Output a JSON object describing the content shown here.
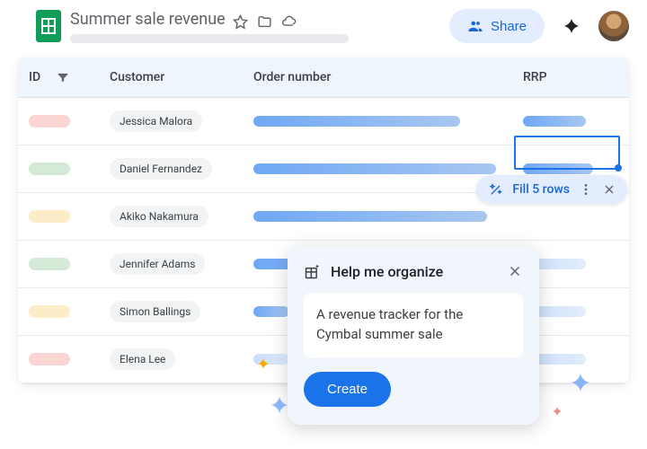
{
  "header": {
    "title": "Summer sale revenue",
    "share_label": "Share"
  },
  "table": {
    "columns": {
      "id": "ID",
      "customer": "Customer",
      "order": "Order number",
      "rrp": "RRP"
    },
    "rows": [
      {
        "id_color": "red",
        "customer": "Jessica Malora",
        "order_w": 230,
        "rrp_w": 70,
        "rrp_faded": false
      },
      {
        "id_color": "green",
        "customer": "Daniel Fernandez",
        "order_w": 270,
        "rrp_w": 78,
        "rrp_faded": false
      },
      {
        "id_color": "yellow",
        "customer": "Akiko Nakamura",
        "order_w": 260,
        "rrp_w": 0,
        "rrp_faded": false
      },
      {
        "id_color": "green",
        "customer": "Jennifer Adams",
        "order_w": 250,
        "rrp_w": 70,
        "rrp_faded": true
      },
      {
        "id_color": "yellow",
        "customer": "Simon Ballings",
        "order_w": 40,
        "rrp_w": 70,
        "rrp_faded": true
      },
      {
        "id_color": "red",
        "customer": "Elena Lee",
        "order_w": 40,
        "rrp_w": 70,
        "rrp_faded": true,
        "order_faded": true
      }
    ]
  },
  "fill_chip": {
    "label": "Fill 5 rows"
  },
  "dialog": {
    "title": "Help me organize",
    "prompt": "A revenue tracker for the Cymbal summer sale",
    "create_label": "Create"
  }
}
